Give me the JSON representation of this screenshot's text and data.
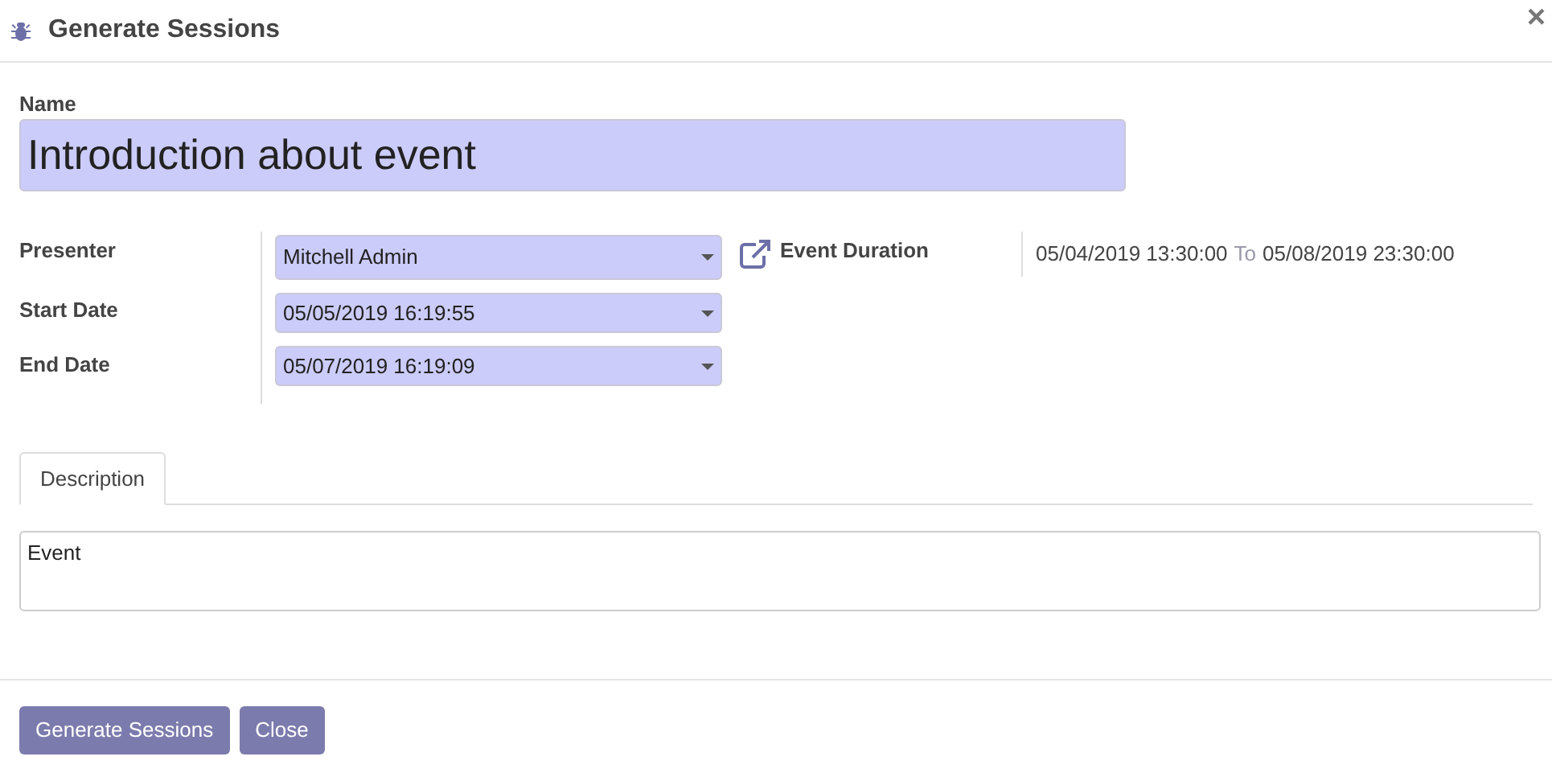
{
  "dialog": {
    "title": "Generate Sessions",
    "close": "×"
  },
  "name": {
    "label": "Name",
    "value": "Introduction about event"
  },
  "fields": [
    {
      "label": "Presenter",
      "value": "Mitchell Admin"
    },
    {
      "label": "Start Date",
      "value": "05/05/2019 16:19:55"
    },
    {
      "label": "End Date",
      "value": "05/07/2019 16:19:09"
    }
  ],
  "event_duration": {
    "label": "Event Duration",
    "start": "05/04/2019 13:30:00",
    "separator": "To",
    "end": "05/08/2019 23:30:00"
  },
  "tabs": [
    {
      "label": "Description",
      "selected": true
    }
  ],
  "description": {
    "value": "Event"
  },
  "buttons": [
    "Generate Sessions",
    "Close"
  ]
}
